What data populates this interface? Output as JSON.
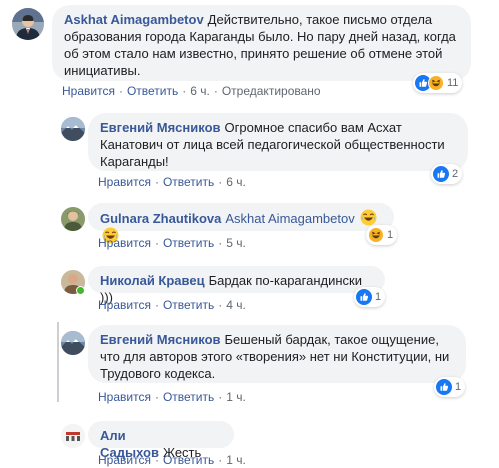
{
  "actions": {
    "like": "Нравится",
    "reply": "Ответить",
    "edited": "Отредактировано"
  },
  "comments": [
    {
      "author": "Askhat Aimagambetov",
      "text": "Действительно, такое письмо отдела образования города Караганды было. Но пару дней назад, когда об этом стало нам известно, принято решение об отмене этой инициативы.",
      "time": "6 ч.",
      "reactions": [
        "like-icon",
        "haha-icon"
      ],
      "reaction_count": "11"
    },
    {
      "author": "Евгений Мясников",
      "text": "Огромное спасибо вам Асхат Канатович от лица всей педагогической общественности Караганды!",
      "time": "6 ч.",
      "reactions": [
        "like-icon"
      ],
      "reaction_count": "2"
    },
    {
      "author": "Gulnara Zhautikova",
      "mention": "Askhat Aimagambetov",
      "emojis": [
        "laughing-emoji",
        "laughing-emoji"
      ],
      "time": "5 ч.",
      "reactions": [
        "haha-icon"
      ],
      "reaction_count": "1"
    },
    {
      "author": "Николай Кравец",
      "text": "Бардак по-карагандински )))",
      "time": "4 ч.",
      "reactions": [
        "like-icon"
      ],
      "reaction_count": "1"
    },
    {
      "author": "Евгений Мясников",
      "text": "Бешеный бардак, такое ощущение, что для авторов этого «творения» нет ни Конституции, ни Трудового кодекса.",
      "time": "1 ч.",
      "reactions": [
        "like-icon"
      ],
      "reaction_count": "1"
    },
    {
      "author": "Али Садыхов",
      "text": "Жесть",
      "time": "1 ч."
    }
  ],
  "colors": {
    "link": "#385898",
    "bubble": "#f2f3f5",
    "like": "#1877f2",
    "haha": "#f7b125",
    "online": "#42b72a"
  }
}
